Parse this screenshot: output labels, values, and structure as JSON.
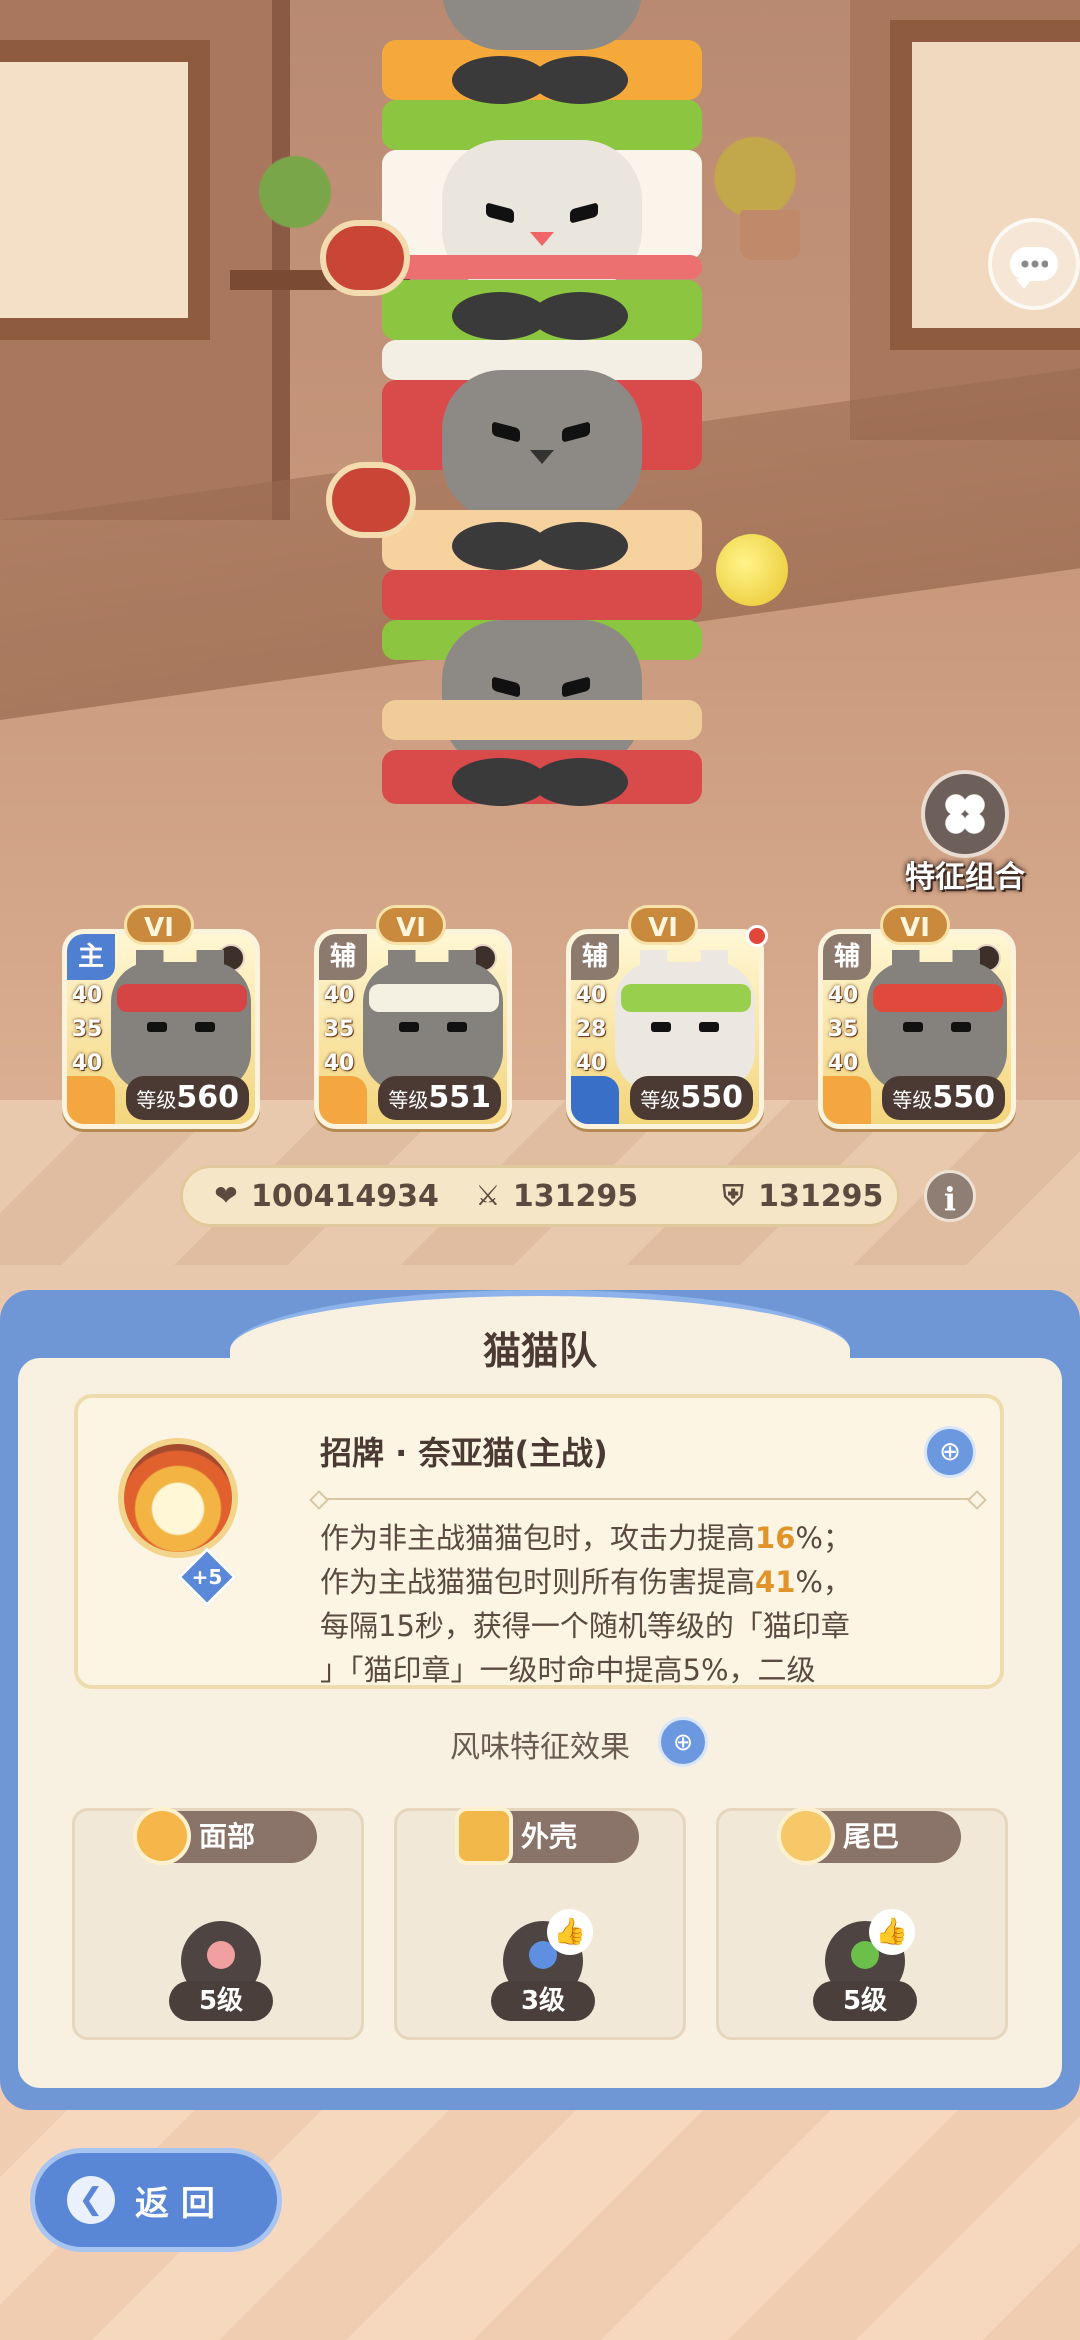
{
  "scene": {
    "feature_combo_label": "特征组合",
    "chat_icon": "chat-bubbles-icon"
  },
  "cards": [
    {
      "rank": "VI",
      "role": "主",
      "role_type": "main",
      "stats": [
        "40",
        "35",
        "40"
      ],
      "level_label": "等级",
      "level": "560",
      "paw": "orange",
      "face": "dark",
      "bar_color": "#d64545",
      "new": false
    },
    {
      "rank": "VI",
      "role": "辅",
      "role_type": "support",
      "stats": [
        "40",
        "35",
        "40"
      ],
      "level_label": "等级",
      "level": "551",
      "paw": "orange",
      "face": "dark",
      "bar_color": "#f4f0e2",
      "new": false
    },
    {
      "rank": "VI",
      "role": "辅",
      "role_type": "support",
      "stats": [
        "40",
        "28",
        "40"
      ],
      "level_label": "等级",
      "level": "550",
      "paw": "blue",
      "face": "light",
      "bar_color": "#98cf4c",
      "new": true
    },
    {
      "rank": "VI",
      "role": "辅",
      "role_type": "support",
      "stats": [
        "40",
        "35",
        "40"
      ],
      "level_label": "等级",
      "level": "550",
      "paw": "orange",
      "face": "dark",
      "bar_color": "#e04a3c",
      "new": false
    }
  ],
  "stats_strip": {
    "hp": "100414934",
    "attack": "131295",
    "defense": "131295",
    "hp_icon": "heart-icon",
    "attack_icon": "crossed-swords-icon",
    "defense_icon": "shield-icon"
  },
  "info_button": "i",
  "panel": {
    "title": "猫猫队",
    "skill": {
      "name": "招牌 · 奈亚猫(主战)",
      "badge": "+5",
      "line1_a": "作为非主战猫猫包时，攻击力提高",
      "line1_hl": "16",
      "line1_b": "%；",
      "line2_a": "作为主战猫猫包时则所有伤害提高",
      "line2_hl": "41",
      "line2_b": "%，",
      "line3": "每隔15秒，获得一个随机等级的「猫印章",
      "line4": "」「猫印章」一级时命中提高5%，二级"
    },
    "flavor_title": "风味特征效果",
    "traits": [
      {
        "label": "面部",
        "level": "5级",
        "icon": "face-icon",
        "emblem_color": "#f0a0a0",
        "thumb": false
      },
      {
        "label": "外壳",
        "level": "3级",
        "icon": "shell-icon",
        "emblem_color": "#5f8fe0",
        "thumb": true
      },
      {
        "label": "尾巴",
        "level": "5级",
        "icon": "tail-icon",
        "emblem_color": "#6bbf4a",
        "thumb": true
      }
    ]
  },
  "back_button": "返 回",
  "colors": {
    "panel_blue": "#6f97d6",
    "highlight": "#e0942a",
    "main_role": "#4f7fd0"
  }
}
